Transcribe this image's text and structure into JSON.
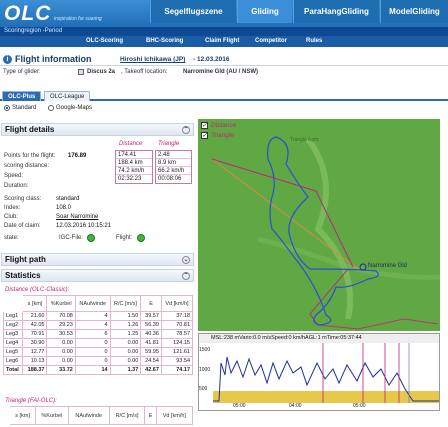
{
  "header": {
    "logo": "OLC",
    "tagline": "inspiration for soaring",
    "tabs": [
      {
        "label": "Segelflugszene",
        "active": false
      },
      {
        "label": "Gliding",
        "active": true
      },
      {
        "label": "ParaHangGliding",
        "active": false
      },
      {
        "label": "ModelGliding",
        "active": false
      }
    ]
  },
  "subnav": {
    "text": "Scoringregion -Period"
  },
  "menu": {
    "items": [
      "OLC-Scoring",
      "BHC-Scoring",
      "Claim Flight",
      "Competitor",
      "Rules"
    ]
  },
  "flightinfo": {
    "title": "Flight information",
    "pilot": "Hiroshi Ichikawa (JP)",
    "date": "- 12.03.2016",
    "glider_label": "Type of glider:",
    "glider": "Discus 2a",
    "takeoff_label": ", Takeoff location:",
    "takeoff": "Narromine Gld (AU / NSW)"
  },
  "league_tabs": [
    "OLC-Plus",
    "OLC-League"
  ],
  "view_options": {
    "standard": "Standard",
    "google": "Google-Maps"
  },
  "flight_details": {
    "title": "Flight details",
    "distance_hdr": "Distance",
    "triangle_hdr": "Triangle",
    "rows": [
      {
        "label": "Points for the flight:",
        "value": "176.89"
      },
      {
        "label": "scoring distance:",
        "value": ""
      },
      {
        "label": "Speed:",
        "value": ""
      },
      {
        "label": "Duration:",
        "value": ""
      }
    ],
    "distance_col": [
      "174.41",
      "188.4 km",
      "74.2 km/h",
      "02:32:23"
    ],
    "triangle_col": [
      "2.48",
      "8.9 km",
      "66.2 km/h",
      "00:08:06"
    ],
    "extra": [
      {
        "label": "Scoring class:",
        "value": "standard"
      },
      {
        "label": "Index:",
        "value": "108.0"
      },
      {
        "label": "Club:",
        "value": "Soar Narromine"
      },
      {
        "label": "Date of claim:",
        "value": "12.03.2016 10:15:21"
      },
      {
        "label": "state:",
        "value": ""
      }
    ],
    "igc_label": "IGC-File:",
    "flight_label": "Flight:"
  },
  "flight_path": {
    "title": "Flight path"
  },
  "statistics": {
    "title": "Statistics",
    "distance_title": "Distance (OLC-Classic):",
    "headers": [
      "s [km]",
      "%Kurbel",
      "NAufwinde",
      "R/C [m/s]",
      "E",
      "Vd [km/h]"
    ],
    "rows": [
      [
        "Leg1",
        "21.60",
        "70.08",
        "4",
        "1.50",
        "39.57",
        "37.18"
      ],
      [
        "Leg2",
        "42.05",
        "29.23",
        "4",
        "1.26",
        "56.30",
        "70.81"
      ],
      [
        "Leg3",
        "70.91",
        "30.53",
        "6",
        "1.25",
        "40.36",
        "78.57"
      ],
      [
        "Leg4",
        "30.90",
        "0.00",
        "0",
        "0.00",
        "41.81",
        "124.15"
      ],
      [
        "Leg5",
        "12.77",
        "0.00",
        "0",
        "0.00",
        "59.95",
        "121.61"
      ],
      [
        "Leg6",
        "10.13",
        "0.00",
        "0",
        "0.00",
        "24.54",
        "93.54"
      ],
      [
        "Total",
        "188.37",
        "33.72",
        "14",
        "1.37",
        "42.67",
        "74.17"
      ]
    ],
    "triangle_title": "Triangle (FAI-OLC):",
    "triangle_headers": [
      "s [km]",
      "%Kurbel",
      "NAufwinde",
      "R/C [m/s]",
      "E",
      "Vd [km/h]"
    ]
  },
  "map": {
    "legend": [
      "Distance",
      "Triangle"
    ],
    "places": [
      "Narromine Gld",
      "Trangie Agric"
    ]
  },
  "barogram": {
    "readout": "MSL:238 mVario:0.0 m/sSpeed:0 km/hAGL:1 mTime:05:37:44",
    "y_ticks": [
      "1500",
      "1000",
      "500"
    ],
    "x_ticks": [
      "05:00",
      "04:00",
      "05:00"
    ]
  },
  "colors": {
    "accent": "#2b6db5",
    "distance": "#c0257a",
    "map_bg": "#6ab34a"
  }
}
